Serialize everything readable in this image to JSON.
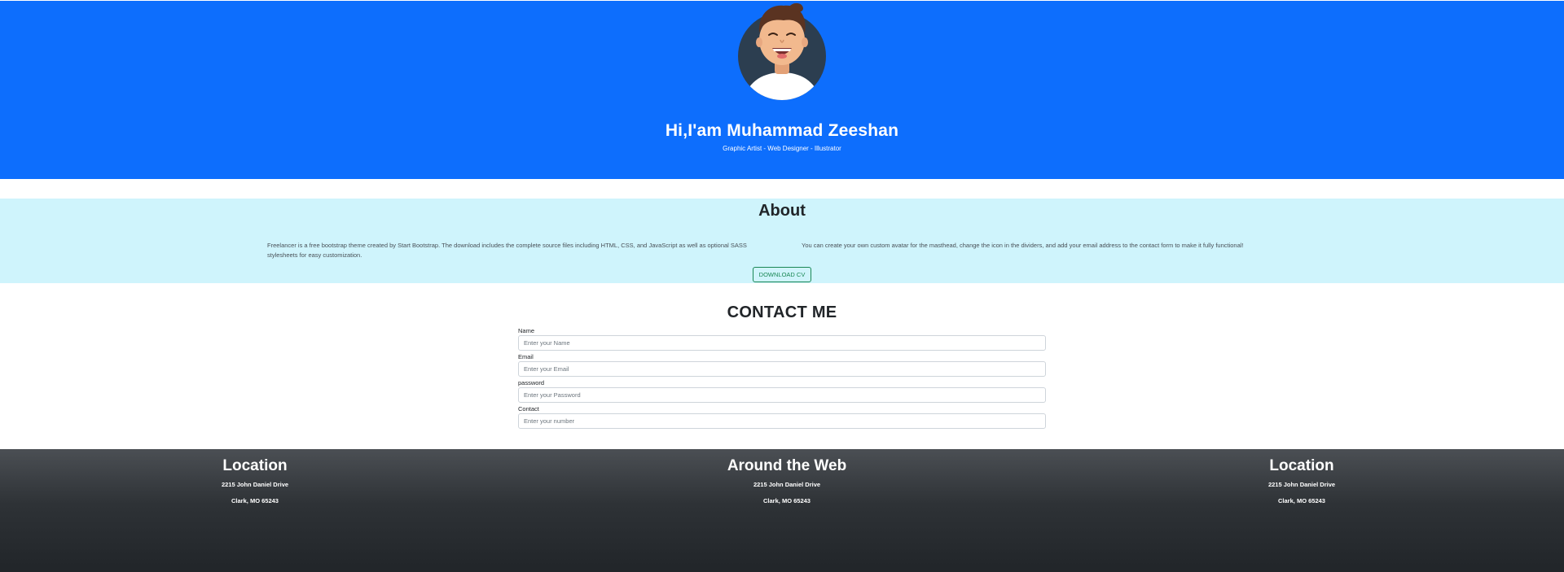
{
  "hero": {
    "title": "Hi,I'am Muhammad Zeeshan",
    "subtitle": "Graphic Artist - Web Designer - Illustrator"
  },
  "about": {
    "title": "About",
    "left_text": "Freelancer is a free bootstrap theme created by Start Bootstrap. The download includes the complete source files including HTML, CSS, and JavaScript as well as optional SASS stylesheets for easy customization.",
    "right_text": "You can create your own custom avatar for the masthead, change the icon in the dividers, and add your email address to the contact form to make it fully functional!",
    "button_label": "DOWNLOAD CV"
  },
  "contact": {
    "title": "CONTACT ME",
    "fields": [
      {
        "label": "Name",
        "placeholder": "Enter your Name"
      },
      {
        "label": "Email",
        "placeholder": "Enter your Email"
      },
      {
        "label": "password",
        "placeholder": "Enter your Password"
      },
      {
        "label": "Contact",
        "placeholder": "Enter your number"
      }
    ]
  },
  "footer": {
    "columns": [
      {
        "title": "Location",
        "line1": "2215 John Daniel Drive",
        "line2": "Clark, MO 65243"
      },
      {
        "title": "Around the Web",
        "line1": "2215 John Daniel Drive",
        "line2": "Clark, MO 65243"
      },
      {
        "title": "Location",
        "line1": "2215 John Daniel Drive",
        "line2": "Clark, MO 65243"
      }
    ]
  },
  "colors": {
    "masthead": "#0d6efd",
    "about_bg": "#cff4fc",
    "button_outline": "#198754",
    "footer_dark": "#212529"
  },
  "icons": {
    "avatar": "cartoon-avatar-icon"
  }
}
